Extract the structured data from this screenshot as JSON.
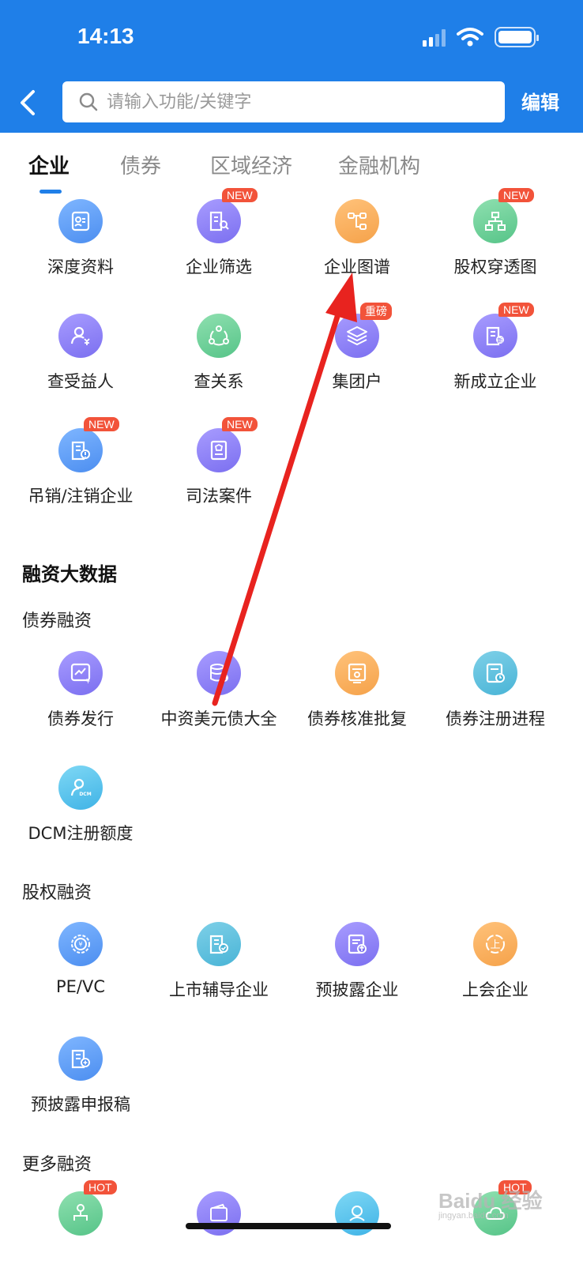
{
  "status": {
    "time": "14:13"
  },
  "header": {
    "search_placeholder": "请输入功能/关键字",
    "edit_label": "编辑"
  },
  "tabs": [
    {
      "label": "企业",
      "active": true
    },
    {
      "label": "债券",
      "active": false
    },
    {
      "label": "区域经济",
      "active": false
    },
    {
      "label": "金融机构",
      "active": false
    }
  ],
  "enterprise_items": [
    {
      "label": "深度资料",
      "icon": "profile-card-icon",
      "badge": ""
    },
    {
      "label": "企业筛选",
      "icon": "building-search-icon",
      "badge": "NEW"
    },
    {
      "label": "企业图谱",
      "icon": "tree-graph-icon",
      "badge": ""
    },
    {
      "label": "股权穿透图",
      "icon": "hierarchy-icon",
      "badge": "NEW"
    },
    {
      "label": "查受益人",
      "icon": "beneficiary-icon",
      "badge": ""
    },
    {
      "label": "查关系",
      "icon": "relation-network-icon",
      "badge": ""
    },
    {
      "label": "集团户",
      "icon": "layers-icon",
      "badge": "重磅"
    },
    {
      "label": "新成立企业",
      "icon": "new-building-icon",
      "badge": "NEW"
    },
    {
      "label": "吊销/注销企业",
      "icon": "revoked-building-icon",
      "badge": "NEW"
    },
    {
      "label": "司法案件",
      "icon": "judicial-document-icon",
      "badge": "NEW"
    }
  ],
  "financing": {
    "title": "融资大数据",
    "bond_title": "债券融资",
    "bond_items": [
      {
        "label": "债券发行",
        "icon": "bond-chart-icon"
      },
      {
        "label": "中资美元债大全",
        "icon": "database-dollar-icon"
      },
      {
        "label": "债券核准批复",
        "icon": "approval-document-icon"
      },
      {
        "label": "债券注册进程",
        "icon": "registration-clock-icon"
      },
      {
        "label": "DCM注册额度",
        "icon": "dcm-user-icon"
      }
    ],
    "equity_title": "股权融资",
    "equity_items": [
      {
        "label": "PE/VC",
        "icon": "coin-target-icon"
      },
      {
        "label": "上市辅导企业",
        "icon": "listing-building-icon"
      },
      {
        "label": "预披露企业",
        "icon": "disclosure-upload-icon"
      },
      {
        "label": "上会企业",
        "icon": "meeting-circle-icon"
      },
      {
        "label": "预披露申报稿",
        "icon": "draft-building-icon"
      }
    ],
    "more_title": "更多融资",
    "more_items": [
      {
        "label": "",
        "icon": "fund-tree-icon",
        "badge": "HOT"
      },
      {
        "label": "",
        "icon": "wallet-icon",
        "badge": ""
      },
      {
        "label": "",
        "icon": "handshake-icon",
        "badge": ""
      },
      {
        "label": "",
        "icon": "cloud-icon",
        "badge": "HOT"
      }
    ]
  },
  "watermark": {
    "text": "Baidu 经验",
    "sub": "jingyan.baidu.com"
  },
  "colors": {
    "primary": "#1f7fe8",
    "badge": "#f2533a",
    "arrow": "#e8231f"
  }
}
